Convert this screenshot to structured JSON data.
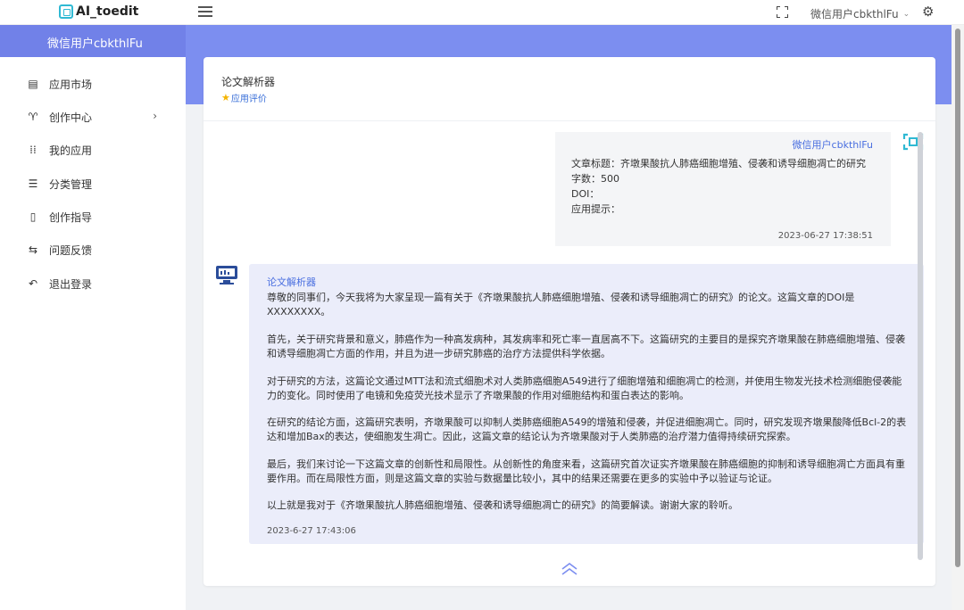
{
  "topbar": {
    "logo": "AI_toedit",
    "user_name": "微信用户cbkthlFu",
    "user_chevron": "⌄",
    "gear_icon": "⚙"
  },
  "sidebar": {
    "header_user": "微信用户cbkthlFu",
    "items": [
      {
        "label": "应用市场",
        "icon": "store-icon",
        "glyph": "▤"
      },
      {
        "label": "创作中心",
        "icon": "trophy-icon",
        "glyph": "♈",
        "arrow": "›"
      },
      {
        "label": "我的应用",
        "icon": "grid-icon",
        "glyph": "⁞⁞"
      },
      {
        "label": "分类管理",
        "icon": "list-icon",
        "glyph": "☰"
      },
      {
        "label": "创作指导",
        "icon": "document-icon",
        "glyph": "▯"
      },
      {
        "label": "问题反馈",
        "icon": "feedback-icon",
        "glyph": "⇆"
      },
      {
        "label": "退出登录",
        "icon": "logout-icon",
        "glyph": "↶"
      }
    ]
  },
  "card": {
    "title": "论文解析器",
    "rate_label": "应用评价",
    "rate_icon": "★"
  },
  "user_message": {
    "user_name": "微信用户cbkthlFu",
    "lines": [
      "文章标题：齐墩果酸抗人肺癌细胞增殖、侵袭和诱导细胞凋亡的研究",
      "字数：500",
      "DOI：",
      "应用提示："
    ],
    "timestamp": "2023-06-27 17:38:51"
  },
  "bot_message": {
    "bot_name": "论文解析器",
    "paragraphs": [
      "尊敬的同事们，今天我将为大家呈现一篇有关于《齐墩果酸抗人肺癌细胞增殖、侵袭和诱导细胞凋亡的研究》的论文。这篇文章的DOI是XXXXXXXX。",
      "首先，关于研究背景和意义，肺癌作为一种高发病种，其发病率和死亡率一直居高不下。这篇研究的主要目的是探究齐墩果酸在肺癌细胞增殖、侵袭和诱导细胞凋亡方面的作用，并且为进一步研究肺癌的治疗方法提供科学依据。",
      "对于研究的方法，这篇论文通过MTT法和流式细胞术对人类肺癌细胞A549进行了细胞增殖和细胞凋亡的检测，并使用生物发光技术检测细胞侵袭能力的变化。同时使用了电镜和免疫荧光技术显示了齐墩果酸的作用对细胞结构和蛋白表达的影响。",
      "在研究的结论方面，这篇研究表明，齐墩果酸可以抑制人类肺癌细胞A549的增殖和侵袭，并促进细胞凋亡。同时，研究发现齐墩果酸降低Bcl-2的表达和增加Bax的表达，使细胞发生凋亡。因此，这篇文章的结论认为齐墩果酸对于人类肺癌的治疗潜力值得持续研究探索。",
      "最后，我们来讨论一下这篇文章的创新性和局限性。从创新性的角度来看，这篇研究首次证实齐墩果酸在肺癌细胞的抑制和诱导细胞凋亡方面具有重要作用。而在局限性方面，则是这篇文章的实验与数据量比较小，其中的结果还需要在更多的实验中予以验证与论证。",
      "以上就是我对于《齐墩果酸抗人肺癌细胞增殖、侵袭和诱导细胞凋亡的研究》的简要解读。谢谢大家的聆听。"
    ],
    "timestamp": "2023-6-27 17:43:06"
  },
  "colors": {
    "accent": "#7c8ef0",
    "link": "#4a6fe0",
    "bot_bubble": "#ebedfa",
    "user_bubble": "#f4f5f7"
  }
}
